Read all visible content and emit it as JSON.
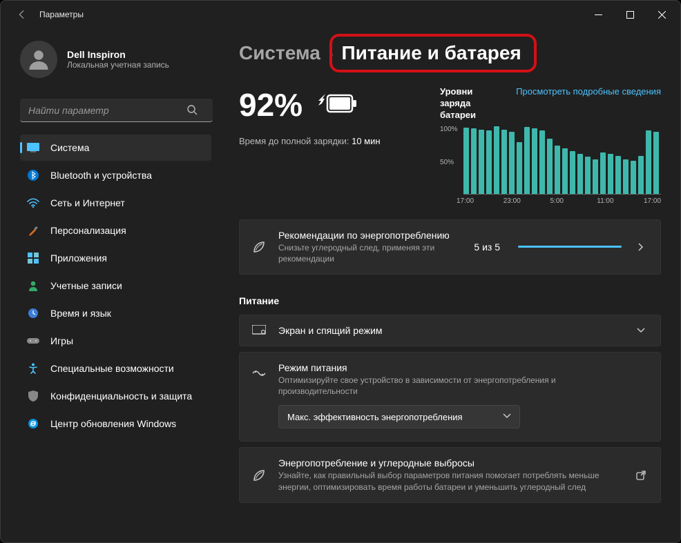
{
  "window": {
    "title": "Параметры"
  },
  "user": {
    "name": "Dell Inspiron",
    "account_type": "Локальная учетная запись"
  },
  "search": {
    "placeholder": "Найти параметр"
  },
  "sidebar": {
    "items": [
      {
        "label": "Система",
        "selected": true
      },
      {
        "label": "Bluetooth и устройства"
      },
      {
        "label": "Сеть и Интернет"
      },
      {
        "label": "Персонализация"
      },
      {
        "label": "Приложения"
      },
      {
        "label": "Учетные записи"
      },
      {
        "label": "Время и язык"
      },
      {
        "label": "Игры"
      },
      {
        "label": "Специальные возможности"
      },
      {
        "label": "Конфиденциальность и защита"
      },
      {
        "label": "Центр обновления Windows"
      }
    ]
  },
  "breadcrumb": {
    "parent": "Система",
    "current": "Питание и батарея"
  },
  "battery": {
    "percent": "92%",
    "time_full_label": "Время до полной зарядки:",
    "time_full_value": "10 мин"
  },
  "chart_link": "Просмотреть подробные сведения",
  "chart_data": {
    "type": "bar",
    "title": "Уровни заряда батареи",
    "ylabel": "",
    "ylim": [
      0,
      100
    ],
    "yticks": [
      "100%",
      "50%"
    ],
    "xticks": [
      "17:00",
      "23:00",
      "5:00",
      "11:00",
      "17:00"
    ],
    "values": [
      96,
      95,
      93,
      92,
      98,
      93,
      90,
      75,
      97,
      95,
      92,
      80,
      70,
      66,
      62,
      58,
      54,
      50,
      60,
      58,
      55,
      50,
      48,
      55,
      92,
      90
    ]
  },
  "cards": {
    "rec": {
      "title": "Рекомендации по энергопотреблению",
      "desc": "Снизьте углеродный след, применяя эти рекомендации",
      "progress_text": "5 из 5",
      "progress_value": 100
    },
    "screen": {
      "title": "Экран и спящий режим"
    },
    "mode": {
      "title": "Режим питания",
      "desc": "Оптимизируйте свое устройство в зависимости от энергопотребления и производительности",
      "dropdown": "Макс. эффективность энергопотребления"
    },
    "carbon": {
      "title": "Энергопотребление и углеродные выбросы",
      "desc": "Узнайте, как правильный выбор параметров питания помогает потреблять меньше энергии, оптимизировать время работы батареи и уменьшить углеродный след"
    }
  },
  "section": {
    "power": "Питание"
  }
}
